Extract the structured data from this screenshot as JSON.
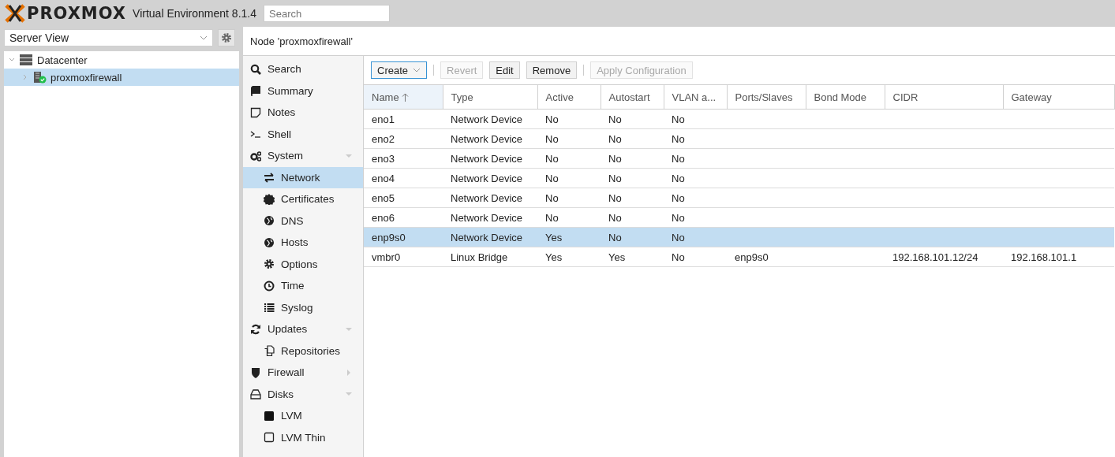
{
  "header": {
    "logo": "PROXMOX",
    "product": "Virtual Environment 8.1.4",
    "search": {
      "placeholder": "Search"
    }
  },
  "sidebar": {
    "view": "Server View",
    "tree": [
      {
        "label": "Datacenter",
        "expanded": true,
        "selected": false,
        "children": [
          {
            "label": "proxmoxfirewall",
            "expanded": false,
            "selected": true
          }
        ]
      }
    ]
  },
  "panel": {
    "title": "Node 'proxmoxfirewall'"
  },
  "menu": [
    {
      "label": "Search",
      "selected": false
    },
    {
      "label": "Summary",
      "selected": false
    },
    {
      "label": "Notes",
      "selected": false
    },
    {
      "label": "Shell",
      "selected": false
    },
    {
      "label": "System",
      "selected": false,
      "expanded": true,
      "children": [
        {
          "label": "Network",
          "selected": true
        },
        {
          "label": "Certificates",
          "selected": false
        },
        {
          "label": "DNS",
          "selected": false
        },
        {
          "label": "Hosts",
          "selected": false
        },
        {
          "label": "Options",
          "selected": false
        },
        {
          "label": "Time",
          "selected": false
        },
        {
          "label": "Syslog",
          "selected": false
        }
      ]
    },
    {
      "label": "Updates",
      "selected": false,
      "expanded": true,
      "children": [
        {
          "label": "Repositories",
          "selected": false
        }
      ]
    },
    {
      "label": "Firewall",
      "selected": false,
      "expanded": false
    },
    {
      "label": "Disks",
      "selected": false,
      "expanded": true,
      "children": [
        {
          "label": "LVM",
          "selected": false
        },
        {
          "label": "LVM Thin",
          "selected": false
        }
      ]
    }
  ],
  "toolbar": [
    {
      "kind": "menu-button",
      "label": "Create",
      "disabled": false
    },
    {
      "kind": "separator"
    },
    {
      "kind": "button",
      "label": "Revert",
      "disabled": true
    },
    {
      "kind": "button",
      "label": "Edit",
      "disabled": false
    },
    {
      "kind": "button",
      "label": "Remove",
      "disabled": false
    },
    {
      "kind": "separator"
    },
    {
      "kind": "button",
      "label": "Apply Configuration",
      "disabled": true
    }
  ],
  "table": {
    "columns": [
      {
        "label": "Name",
        "sorted": true
      },
      {
        "label": "Type",
        "sorted": false
      },
      {
        "label": "Active",
        "sorted": false
      },
      {
        "label": "Autostart",
        "sorted": false
      },
      {
        "label": "VLAN a...",
        "sorted": false
      },
      {
        "label": "Ports/Slaves",
        "sorted": false
      },
      {
        "label": "Bond Mode",
        "sorted": false
      },
      {
        "label": "CIDR",
        "sorted": false
      },
      {
        "label": "Gateway",
        "sorted": false
      }
    ],
    "rows": [
      {
        "selected": false,
        "cells": [
          "eno1",
          "Network Device",
          "No",
          "No",
          "No",
          "",
          "",
          "",
          ""
        ]
      },
      {
        "selected": false,
        "cells": [
          "eno2",
          "Network Device",
          "No",
          "No",
          "No",
          "",
          "",
          "",
          ""
        ]
      },
      {
        "selected": false,
        "cells": [
          "eno3",
          "Network Device",
          "No",
          "No",
          "No",
          "",
          "",
          "",
          ""
        ]
      },
      {
        "selected": false,
        "cells": [
          "eno4",
          "Network Device",
          "No",
          "No",
          "No",
          "",
          "",
          "",
          ""
        ]
      },
      {
        "selected": false,
        "cells": [
          "eno5",
          "Network Device",
          "No",
          "No",
          "No",
          "",
          "",
          "",
          ""
        ]
      },
      {
        "selected": false,
        "cells": [
          "eno6",
          "Network Device",
          "No",
          "No",
          "No",
          "",
          "",
          "",
          ""
        ]
      },
      {
        "selected": true,
        "cells": [
          "enp9s0",
          "Network Device",
          "Yes",
          "No",
          "No",
          "",
          "",
          "",
          ""
        ]
      },
      {
        "selected": false,
        "cells": [
          "vmbr0",
          "Linux Bridge",
          "Yes",
          "Yes",
          "No",
          "enp9s0",
          "",
          "192.168.101.12/24",
          "192.168.101.1"
        ]
      }
    ]
  }
}
